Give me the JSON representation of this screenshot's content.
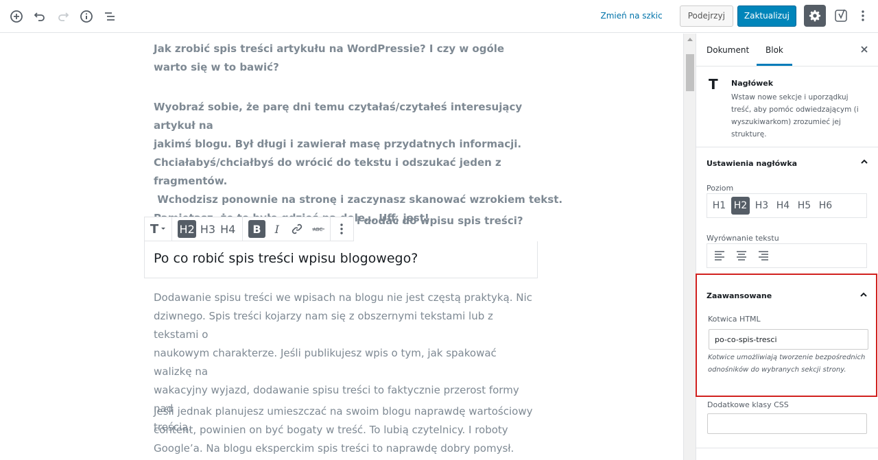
{
  "toolbar": {
    "switch_to_draft": "Zmień na szkic",
    "preview": "Podejrzyj",
    "update": "Zaktualizuj"
  },
  "content": {
    "paragraph1": "Jak zrobić spis treści artykułu na WordPressie? I czy w ogóle warto się w to bawić?",
    "paragraph2_lines": [
      "Wyobraź sobie, że parę dni temu czytałaś/czytałeś interesujący artykuł na",
      "jakimś blogu. Był długi i zawierał masę przydatnych informacji.",
      "Chciałabyś/chciałbyś do wrócić do tekstu i odszukać jeden z fragmentów.",
      " Wchodzisz ponownie na stronę i zaczynasz skanować wzrokiem tekst.",
      "Pamiętasz, że to było gdzieś na dole… Uff, jest!"
    ],
    "paragraph3_tail": "i dodać do wpisu spis treści?",
    "heading": "Po co robić spis treści wpisu blogowego?",
    "paragraph4_lines": [
      "Dodawanie spisu treści we wpisach na blogu nie jest częstą praktyką. Nic",
      "dziwnego. Spis treści kojarzy nam się z obszernymi tekstami lub z tekstami o",
      "naukowym charakterze. Jeśli publikujesz wpis o tym, jak spakować walizkę na",
      "wakacyjny wyjazd, dodawanie spisu treści to faktycznie przerost formy nad",
      "treścią."
    ],
    "paragraph5_lines": [
      "Jeśli jednak planujesz umieszczać na swoim blogu naprawdę wartościowy",
      "content, powinien on być bogaty w treść. To lubią czytelnicy. I roboty",
      "Google’a. Na blogu eksperckim spis treści to naprawdę dobry pomysł."
    ]
  },
  "block_toolbar": {
    "type_icon": "T",
    "h2": "H2",
    "h3": "H3",
    "h4": "H4",
    "bold": "B",
    "italic": "I"
  },
  "sidebar": {
    "tab_document": "Dokument",
    "tab_block": "Blok",
    "block_name": "Nagłówek",
    "block_desc": "Wstaw nowe sekcje i uporządkuj treść, aby pomóc odwiedzającym (i wyszukiwarkom) zrozumieć jej strukturę.",
    "heading_settings": "Ustawienia nagłówka",
    "level_label": "Poziom",
    "levels": [
      "H1",
      "H2",
      "H3",
      "H4",
      "H5",
      "H6"
    ],
    "selected_level": "H2",
    "alignment_label": "Wyrównanie tekstu",
    "advanced": "Zaawansowane",
    "anchor_label": "Kotwica HTML",
    "anchor_value": "po-co-spis-tresci",
    "anchor_help": "Kotwice umożliwiają tworzenie bezpośrednich odnośników do wybranych sekcji strony.",
    "css_label": "Dodatkowe klasy CSS",
    "css_value": ""
  },
  "colors": {
    "primary": "#0085ba",
    "highlight_border": "#d1201e",
    "active_dark": "#555d66"
  }
}
